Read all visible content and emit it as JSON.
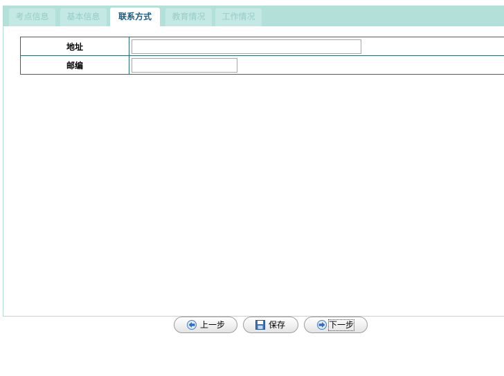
{
  "tabs": [
    {
      "label": "考点信息",
      "active": false
    },
    {
      "label": "基本信息",
      "active": false
    },
    {
      "label": "联系方式",
      "active": true
    },
    {
      "label": "教育情况",
      "active": false
    },
    {
      "label": "工作情况",
      "active": false
    }
  ],
  "form": {
    "address_label": "地址",
    "address_value": "",
    "zip_label": "邮编",
    "zip_value": ""
  },
  "buttons": {
    "prev": {
      "label": "上一步",
      "icon": "arrow-left-icon"
    },
    "save": {
      "label": "保存",
      "icon": "floppy-disk-icon"
    },
    "next": {
      "label": "下一步",
      "icon": "arrow-right-icon"
    }
  },
  "colors": {
    "tab_bar": "#b3e1da",
    "inactive_tab_text": "#97cdc5",
    "active_tab_text": "#1f5b7a",
    "table_border": "#286a76"
  }
}
